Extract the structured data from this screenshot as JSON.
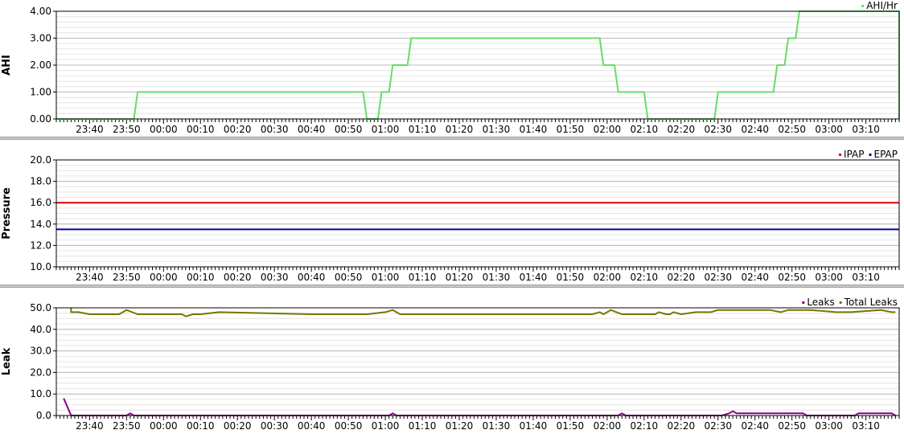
{
  "x_tick_labels": [
    "23:40",
    "23:50",
    "00:00",
    "00:10",
    "00:20",
    "00:30",
    "00:40",
    "00:50",
    "01:00",
    "01:10",
    "01:20",
    "01:30",
    "01:40",
    "01:50",
    "02:00",
    "02:10",
    "02:20",
    "02:30",
    "02:40",
    "02:50",
    "03:00",
    "03:10"
  ],
  "chart_data": [
    {
      "type": "line",
      "ylabel": "AHI",
      "ylim": [
        0,
        4
      ],
      "yticks": [
        "0.00",
        "1.00",
        "2.00",
        "3.00",
        "4.00"
      ],
      "x_range": [
        "23:31",
        "03:19"
      ],
      "grid": true,
      "legend_position": "top-right",
      "series": [
        {
          "name": "AHI/Hr",
          "color": "#66dd66",
          "x": [
            "23:31",
            "23:52",
            "23:53",
            "00:54",
            "00:55",
            "00:58",
            "00:59",
            "01:01",
            "01:02",
            "01:06",
            "01:07",
            "01:11",
            "01:12",
            "01:58",
            "01:59",
            "02:02",
            "02:03",
            "02:10",
            "02:11",
            "02:29",
            "02:30",
            "02:45",
            "02:46",
            "02:48",
            "02:49",
            "02:51",
            "02:52",
            "03:19",
            "03:19"
          ],
          "y": [
            0,
            0,
            1,
            1,
            0,
            0,
            1,
            1,
            2,
            2,
            3,
            3,
            3,
            3,
            2,
            2,
            1,
            1,
            0,
            0,
            1,
            1,
            2,
            2,
            3,
            3,
            4,
            4,
            0
          ]
        }
      ]
    },
    {
      "type": "line",
      "ylabel": "Pressure",
      "ylim": [
        10,
        20
      ],
      "yticks": [
        "10.0",
        "12.0",
        "14.0",
        "16.0",
        "18.0",
        "20.0"
      ],
      "x_range": [
        "23:31",
        "03:19"
      ],
      "grid": true,
      "legend_position": "top-right",
      "series": [
        {
          "name": "IPAP",
          "color": "#dd0000",
          "x": [
            "23:31",
            "03:19"
          ],
          "y": [
            16,
            16
          ]
        },
        {
          "name": "EPAP",
          "color": "#0000aa",
          "x": [
            "23:31",
            "03:19"
          ],
          "y": [
            13.5,
            13.5
          ]
        }
      ]
    },
    {
      "type": "line",
      "ylabel": "Leak",
      "ylim": [
        0,
        50
      ],
      "yticks": [
        "0.0",
        "10.0",
        "20.0",
        "30.0",
        "40.0",
        "50.0"
      ],
      "x_range": [
        "23:31",
        "03:19"
      ],
      "grid": true,
      "legend_position": "top-right",
      "series": [
        {
          "name": "Leaks",
          "color": "#880088",
          "x": [
            "23:33",
            "23:35",
            "23:36",
            "23:50",
            "23:51",
            "23:52",
            "01:01",
            "01:02",
            "01:03",
            "02:03",
            "02:04",
            "02:05",
            "02:31",
            "02:33",
            "02:34",
            "02:35",
            "02:36",
            "02:53",
            "02:54",
            "03:07",
            "03:08",
            "03:15",
            "03:17",
            "03:18"
          ],
          "y": [
            8,
            0,
            0,
            0,
            1,
            0,
            0,
            1,
            0,
            0,
            1,
            0,
            0,
            1,
            2,
            1,
            1,
            1,
            0,
            0,
            1,
            1,
            1,
            0
          ]
        },
        {
          "name": "Total Leaks",
          "color": "#777700",
          "x": [
            "23:35",
            "23:35",
            "23:37",
            "23:40",
            "23:48",
            "23:50",
            "23:53",
            "00:05",
            "00:06",
            "00:08",
            "00:10",
            "00:15",
            "00:40",
            "00:55",
            "01:00",
            "01:02",
            "01:04",
            "01:30",
            "01:45",
            "01:56",
            "01:58",
            "01:59",
            "02:00",
            "02:01",
            "02:04",
            "02:10",
            "02:13",
            "02:14",
            "02:16",
            "02:17",
            "02:18",
            "02:20",
            "02:24",
            "02:28",
            "02:30",
            "02:32",
            "02:34",
            "02:44",
            "02:47",
            "02:49",
            "02:52",
            "02:55",
            "03:02",
            "03:06",
            "03:14",
            "03:17",
            "03:18"
          ],
          "y": [
            50,
            48,
            48,
            47,
            47,
            49,
            47,
            47,
            46,
            47,
            47,
            48,
            47,
            47,
            48,
            49,
            47,
            47,
            47,
            47,
            48,
            47,
            48,
            49,
            47,
            47,
            47,
            48,
            47,
            47,
            48,
            47,
            48,
            48,
            49,
            49,
            49,
            49,
            48,
            49,
            49,
            49,
            48,
            48,
            49,
            48,
            48
          ]
        }
      ]
    }
  ]
}
